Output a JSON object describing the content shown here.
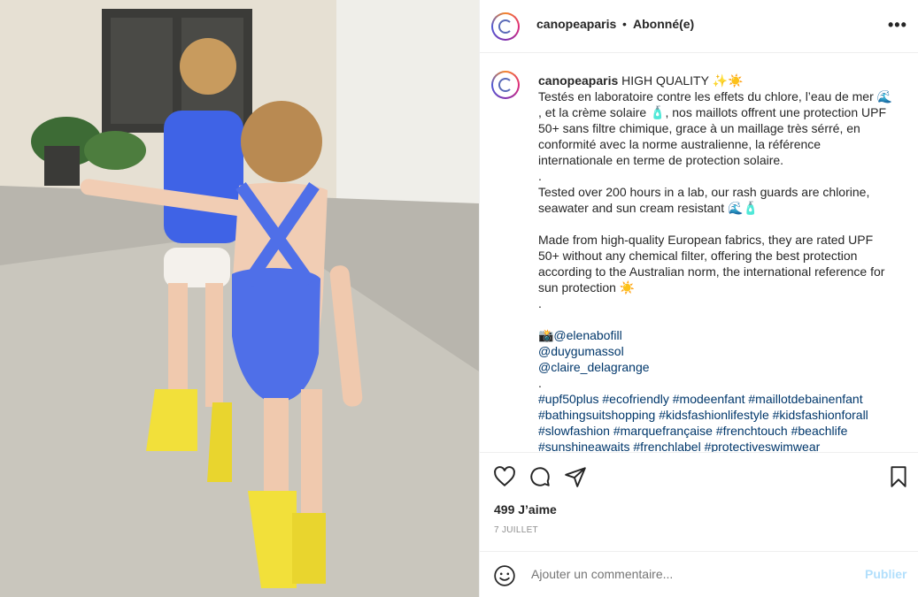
{
  "post": {
    "username": "canopeaparis",
    "separator": "•",
    "follow_status": "Abonné(e)",
    "more_label": "•••",
    "caption": {
      "username": "canopeaparis",
      "lines": [
        "HIGH QUALITY ✨☀️",
        "Testés en laboratoire contre les effets du chlore, l’eau de mer 🌊",
        ", et la crème solaire 🧴, nos maillots offrent une protection UPF",
        "50+ sans filtre chimique, grace à un maillage très sérré, en",
        "conformité avec la norme australienne, la référence",
        "internationale en terme de protection solaire.",
        ".",
        "Tested over 200 hours in a lab, our rash guards are chlorine,",
        "seawater and sun cream resistant 🌊🧴",
        "",
        "Made from high-quality European fabrics, they are rated UPF",
        "50+ without any chemical filter, offering the best protection",
        "according to the Australian norm, the international reference for",
        "sun protection ☀️",
        ".",
        "",
        "📸@elenabofill",
        "@duygumassol",
        "@claire_delagrange",
        ".",
        "#upf50plus #ecofriendly #modeenfant #maillotdebainenfant",
        "#bathingsuitshopping #kidsfashionlifestyle #kidsfashionforall",
        "#slowfashion #marquefrançaise #frenchtouch #beachlife",
        "#sunshineawaits #frenchlabel #protectiveswimwear"
      ]
    },
    "likes": "499 J’aime",
    "date": "7 JUILLET"
  },
  "actions": {
    "like_icon": "heart-icon",
    "comment_icon": "comment-bubble-icon",
    "share_icon": "paper-plane-icon",
    "save_icon": "bookmark-icon"
  },
  "comment": {
    "emoji_icon": "smiley-icon",
    "placeholder": "Ajouter un commentaire...",
    "publish_label": "Publier"
  },
  "colors": {
    "link": "#00376b",
    "publish_disabled": "#b2dffc",
    "swimsuit": "#4f6fe8",
    "boots": "#f2e03a"
  }
}
